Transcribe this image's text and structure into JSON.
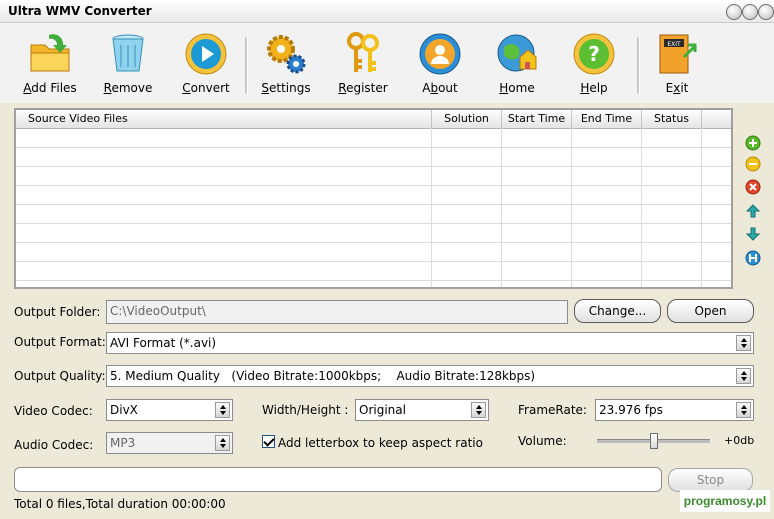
{
  "window": {
    "title": "Ultra WMV Converter"
  },
  "toolbar": {
    "add_files": {
      "pre": "",
      "key": "A",
      "post": "dd Files"
    },
    "remove": {
      "pre": "",
      "key": "R",
      "post": "emove"
    },
    "convert": {
      "pre": "",
      "key": "C",
      "post": "onvert"
    },
    "settings": {
      "pre": "",
      "key": "S",
      "post": "ettings"
    },
    "register": {
      "pre": "",
      "key": "R",
      "post": "egister"
    },
    "about": {
      "pre": "A",
      "key": "b",
      "post": "out"
    },
    "home": {
      "pre": "",
      "key": "H",
      "post": "ome"
    },
    "help": {
      "pre": "",
      "key": "H",
      "post": "elp"
    },
    "exit": {
      "pre": "E",
      "key": "x",
      "post": "it"
    },
    "exit_sign": "EXIT"
  },
  "file_list": {
    "columns": [
      "Source Video Files",
      "Solution",
      "Start Time",
      "End Time",
      "Status"
    ],
    "rows": []
  },
  "output_folder": {
    "label": "Output Folder:",
    "value": "C:\\VideoOutput\\",
    "change_label": "Change...",
    "open_label": "Open"
  },
  "output_format": {
    "label": "Output Format:",
    "value": "AVI Format (*.avi)"
  },
  "output_quality": {
    "label": "Output Quality:",
    "value": "5. Medium Quality   (Video Bitrate:1000kbps;    Audio Bitrate:128kbps)"
  },
  "video_codec": {
    "label": "Video Codec:",
    "value": "DivX"
  },
  "width_height": {
    "label": "Width/Height :",
    "value": "Original"
  },
  "frame_rate": {
    "label": "FrameRate:",
    "value": "23.976 fps"
  },
  "audio_codec": {
    "label": "Audio Codec:",
    "value": "MP3"
  },
  "letterbox": {
    "label": "Add letterbox to keep aspect ratio",
    "checked": true
  },
  "volume": {
    "label": "Volume:",
    "value_text": "+0db",
    "level": 0.5
  },
  "progress": {
    "value": 0
  },
  "stop_label": "Stop",
  "status_text": "Total 0 files,Total duration 00:00:00",
  "watermark": "programosy.pl",
  "colors": {
    "green": "#5bb82a",
    "yellow": "#f2c21a",
    "red": "#e0452c",
    "teal": "#2aa7a7"
  }
}
